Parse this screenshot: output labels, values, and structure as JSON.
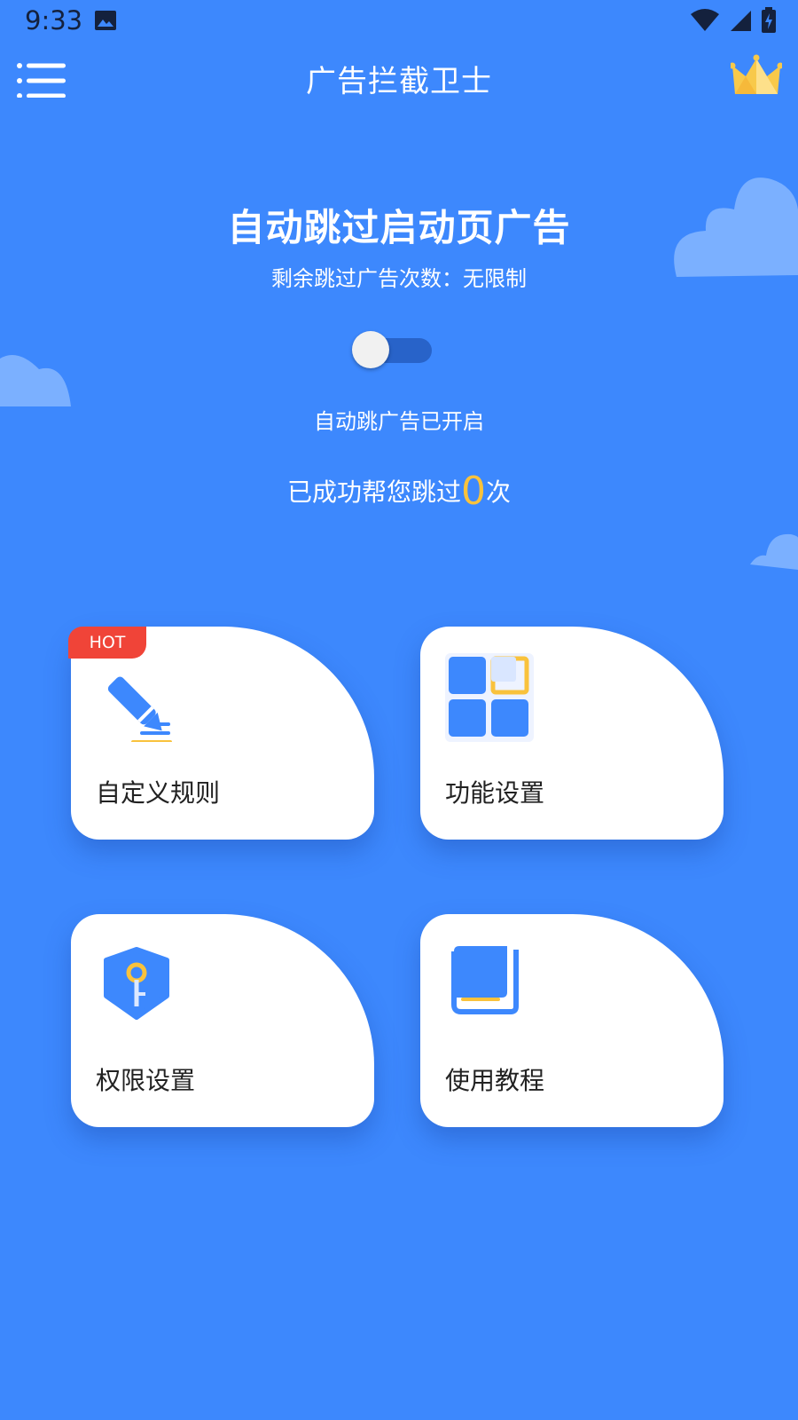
{
  "status_bar": {
    "time": "9:33",
    "icons": [
      "image-icon",
      "wifi-icon",
      "signal-icon",
      "battery-charging-icon"
    ]
  },
  "app_bar": {
    "title": "广告拦截卫士",
    "menu_icon": "menu-icon",
    "vip_icon": "crown-icon"
  },
  "hero": {
    "title": "自动跳过启动页广告",
    "remaining_label": "剩余跳过广告次数：无限制",
    "toggle_status": "自动跳广告已开启",
    "skipped_prefix": "已成功帮您跳过",
    "skipped_count": "0",
    "skipped_suffix": "次"
  },
  "cards": [
    {
      "label": "自定义规则",
      "icon": "pen-rules-icon",
      "badge": "HOT"
    },
    {
      "label": "功能设置",
      "icon": "grid-settings-icon"
    },
    {
      "label": "权限设置",
      "icon": "shield-key-icon"
    },
    {
      "label": "使用教程",
      "icon": "book-icon"
    }
  ],
  "colors": {
    "background": "#3d88fd",
    "accent_yellow": "#f9c23c",
    "badge_red": "#f04438",
    "icon_blue": "#3d88fd",
    "card_bg": "#ffffff"
  }
}
